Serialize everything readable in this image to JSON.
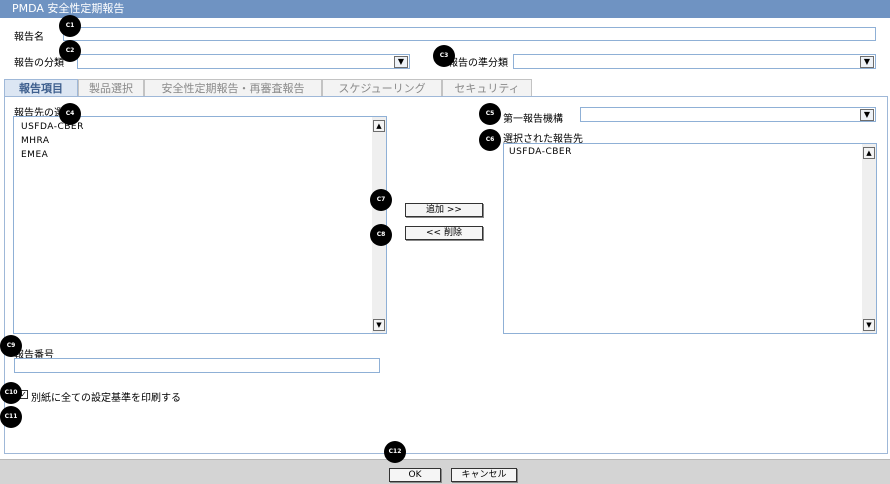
{
  "window": {
    "title": "PMDA 安全性定期報告"
  },
  "form": {
    "report_name_label": "報告名",
    "report_name_value": "",
    "report_category_label": "報告の分類",
    "report_category_value": "",
    "report_subcategory_label": "報告の準分類",
    "report_subcategory_value": ""
  },
  "tabs": [
    {
      "label": "報告項目",
      "active": true
    },
    {
      "label": "製品選択",
      "active": false
    },
    {
      "label": "安全性定期報告・再審査報告",
      "active": false
    },
    {
      "label": "スケジューリング",
      "active": false
    },
    {
      "label": "セキュリティ",
      "active": false
    }
  ],
  "destinations": {
    "available_label": "報告先の選択",
    "available_items": [
      "USFDA-CBER",
      "MHRA",
      "EMEA"
    ],
    "primary_agency_label": "第一報告機構",
    "primary_agency_value": "",
    "selected_label": "選択された報告先",
    "selected_items": [
      "USFDA-CBER"
    ],
    "add_label": "追加 >>",
    "remove_label": "<< 削除"
  },
  "report_number": {
    "label": "報告番号",
    "value": ""
  },
  "print_criteria": {
    "label": "別紙に全ての設定基準を印刷する",
    "checked": true
  },
  "footer": {
    "ok_label": "OK",
    "cancel_label": "キャンセル"
  },
  "callouts": [
    "C1",
    "C2",
    "C3",
    "C4",
    "C5",
    "C6",
    "C7",
    "C8",
    "C9",
    "C10",
    "C11",
    "C12"
  ]
}
